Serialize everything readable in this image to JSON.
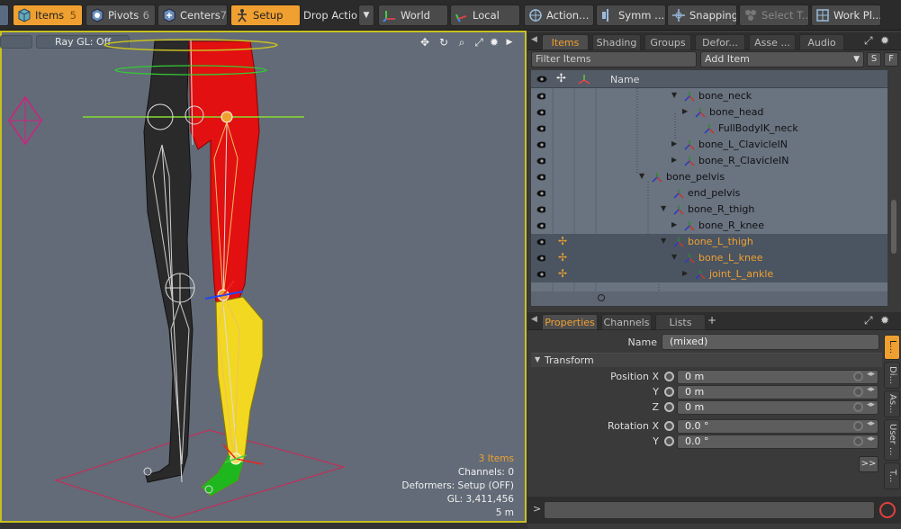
{
  "toolbar": {
    "items": {
      "label": "Items",
      "num": "5"
    },
    "pivots": {
      "label": "Pivots",
      "num": "6"
    },
    "centers": {
      "label": "Centers",
      "num": "7"
    },
    "setup": {
      "label": "Setup"
    },
    "drop_action": {
      "label": "Drop Action"
    },
    "world": {
      "label": "World"
    },
    "local": {
      "label": "Local"
    },
    "action": {
      "label": "Action"
    },
    "symm": {
      "label": "Symm ..."
    },
    "snapping": {
      "label": "Snapping"
    },
    "select_t": {
      "label": "Select T..."
    },
    "work_pl": {
      "label": "Work Pl..."
    }
  },
  "viewport": {
    "raygl_label": "Ray GL: Off",
    "stats": {
      "items": "3 Items",
      "channels": "Channels: 0",
      "deformers": "Deformers: Setup (OFF)",
      "gl": "GL: 3,411,456",
      "scale": "5 m"
    }
  },
  "items_panel": {
    "tabs": [
      "Items",
      "Shading",
      "Groups",
      "Defor...",
      "Asse ...",
      "Audio"
    ],
    "filter_placeholder": "Filter Items",
    "add_item": "Add Item",
    "s_button": "S",
    "f_button": "F",
    "column_name": "Name",
    "rows": [
      {
        "label": "bone_neck",
        "selected": false
      },
      {
        "label": "bone_head",
        "selected": false
      },
      {
        "label": "FullBodyIK_neck",
        "selected": false
      },
      {
        "label": "bone_L_ClavicleIN",
        "selected": false
      },
      {
        "label": "bone_R_ClavicleIN",
        "selected": false
      },
      {
        "label": "bone_pelvis",
        "selected": false
      },
      {
        "label": "end_pelvis",
        "selected": false
      },
      {
        "label": "bone_R_thigh",
        "selected": false
      },
      {
        "label": "bone_R_knee",
        "selected": false
      },
      {
        "label": "bone_L_thigh",
        "selected": true
      },
      {
        "label": "bone_L_knee",
        "selected": true
      },
      {
        "label": "joint_L_ankle",
        "selected": true
      }
    ]
  },
  "properties_panel": {
    "tabs": [
      "Properties",
      "Channels",
      "Lists"
    ],
    "add_tab": "+",
    "name_label": "Name",
    "name_value": "(mixed)",
    "transform_header": "Transform",
    "position": [
      {
        "axis": "Position X",
        "value": "0 m"
      },
      {
        "axis": "Y",
        "value": "0 m"
      },
      {
        "axis": "Z",
        "value": "0 m"
      }
    ],
    "rotation": [
      {
        "axis": "Rotation X",
        "value": "0.0 °"
      },
      {
        "axis": "Y",
        "value": "0.0 °"
      }
    ],
    "side_tabs": [
      "L...",
      "Di...",
      "As...",
      "User ...",
      "T..."
    ],
    "more_button": ">>"
  },
  "command_line": {
    "prompt": ">"
  },
  "colors": {
    "accent": "#f0a030",
    "viewport_border": "#c8c020",
    "viewport_bg": "#626b77",
    "tree_bg": "#6a7380"
  }
}
